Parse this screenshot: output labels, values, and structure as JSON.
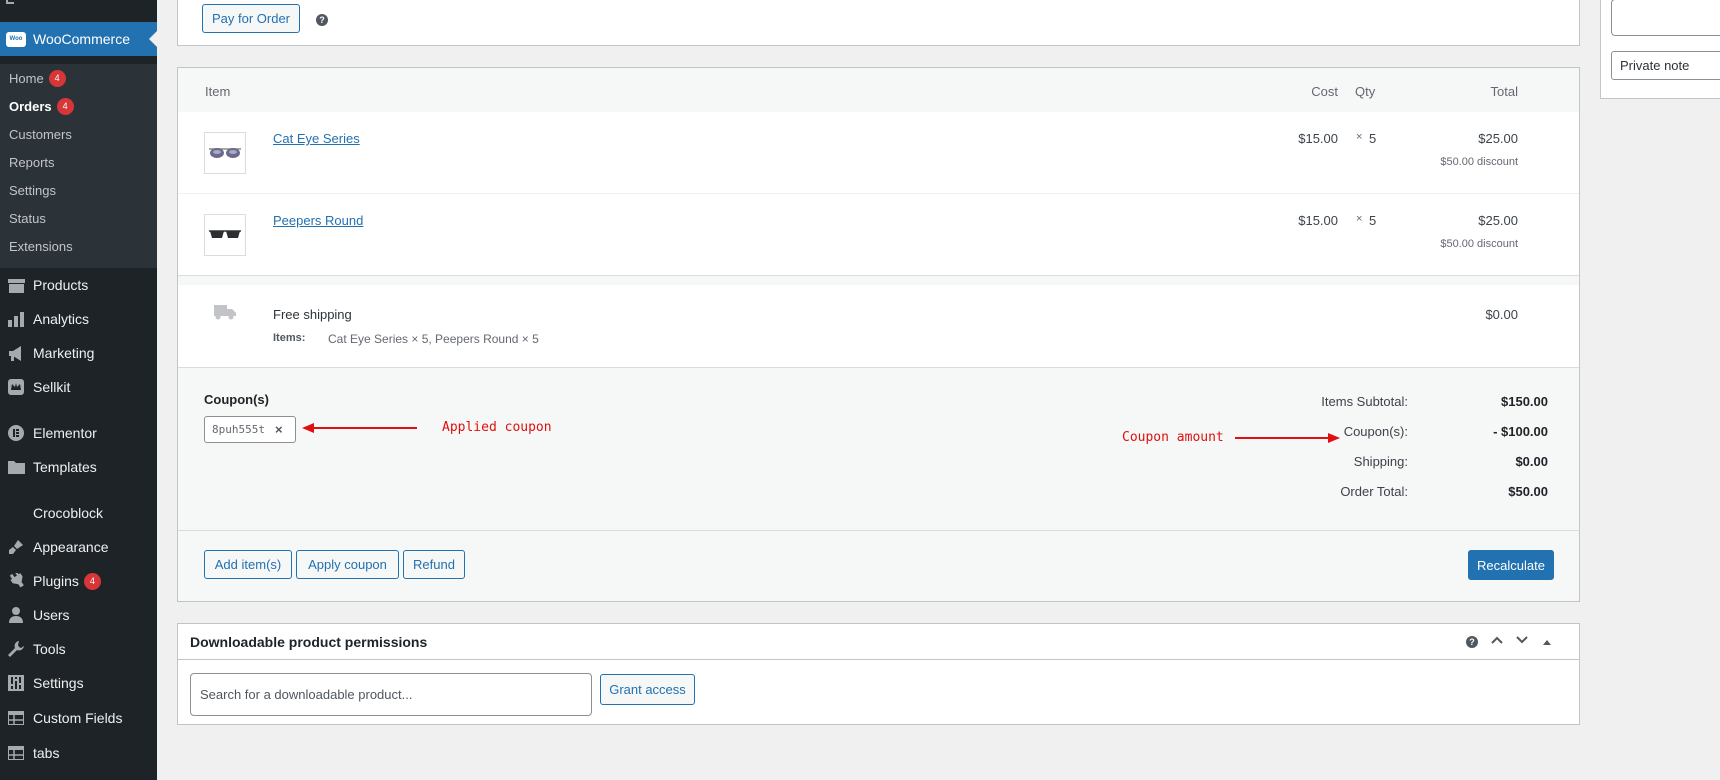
{
  "sidebar": {
    "woocommerce": {
      "logo": "Woo",
      "label": "WooCommerce"
    },
    "submenu": [
      {
        "label": "Home",
        "count": "4"
      },
      {
        "label": "Orders",
        "count": "4"
      },
      {
        "label": "Customers"
      },
      {
        "label": "Reports"
      },
      {
        "label": "Settings"
      },
      {
        "label": "Status"
      },
      {
        "label": "Extensions"
      }
    ],
    "menu": [
      {
        "label": "Products",
        "icon": "archive-icon"
      },
      {
        "label": "Analytics",
        "icon": "bar-chart-icon"
      },
      {
        "label": "Marketing",
        "icon": "megaphone-icon"
      },
      {
        "label": "Sellkit",
        "icon": "crown-icon"
      },
      {
        "label": "Elementor",
        "icon": "elementor-icon"
      },
      {
        "label": "Templates",
        "icon": "folder-icon"
      },
      {
        "label": "Crocoblock",
        "icon": "crocoblock-icon"
      },
      {
        "label": "Appearance",
        "icon": "paintbrush-icon"
      },
      {
        "label": "Plugins",
        "icon": "plugin-icon",
        "count": "4"
      },
      {
        "label": "Users",
        "icon": "user-icon"
      },
      {
        "label": "Tools",
        "icon": "wrench-icon"
      },
      {
        "label": "Settings",
        "icon": "sliders-icon"
      },
      {
        "label": "Custom Fields",
        "icon": "table-icon"
      },
      {
        "label": "tabs",
        "icon": "table-icon"
      }
    ]
  },
  "top": {
    "pay_button": "Pay for Order",
    "help": "?"
  },
  "items_table": {
    "headers": {
      "item": "Item",
      "cost": "Cost",
      "qty": "Qty",
      "total": "Total"
    },
    "rows": [
      {
        "name": "Cat Eye Series",
        "cost": "$15.00",
        "qty_x": "×",
        "qty": "5",
        "total": "$25.00",
        "discount": "$50.00 discount"
      },
      {
        "name": "Peepers Round",
        "cost": "$15.00",
        "qty_x": "×",
        "qty": "5",
        "total": "$25.00",
        "discount": "$50.00 discount"
      }
    ],
    "shipping": {
      "name": "Free shipping",
      "items_label": "Items:",
      "items_value": "Cat Eye Series × 5, Peepers Round × 5",
      "total": "$0.00"
    }
  },
  "coupons": {
    "label": "Coupon(s)",
    "code": "8puh555t",
    "remove": "×",
    "applied_annotation": "Applied coupon",
    "amount_annotation": "Coupon amount"
  },
  "totals": [
    {
      "label": "Items Subtotal:",
      "value": "$150.00"
    },
    {
      "label": "Coupon(s):",
      "value": "- $100.00"
    },
    {
      "label": "Shipping:",
      "value": "$0.00"
    },
    {
      "label": "Order Total:",
      "value": "$50.00"
    }
  ],
  "actions": {
    "add_items": "Add item(s)",
    "apply_coupon": "Apply coupon",
    "refund": "Refund",
    "recalculate": "Recalculate"
  },
  "downloads": {
    "title": "Downloadable product permissions",
    "search_placeholder": "Search for a downloadable product...",
    "grant": "Grant access"
  },
  "note_panel": {
    "note_type": "Private note"
  },
  "colors": {
    "accent": "#2271b1",
    "sidebar_bg": "#1d2327",
    "badge": "#d63638",
    "annotation": "#e01010"
  }
}
